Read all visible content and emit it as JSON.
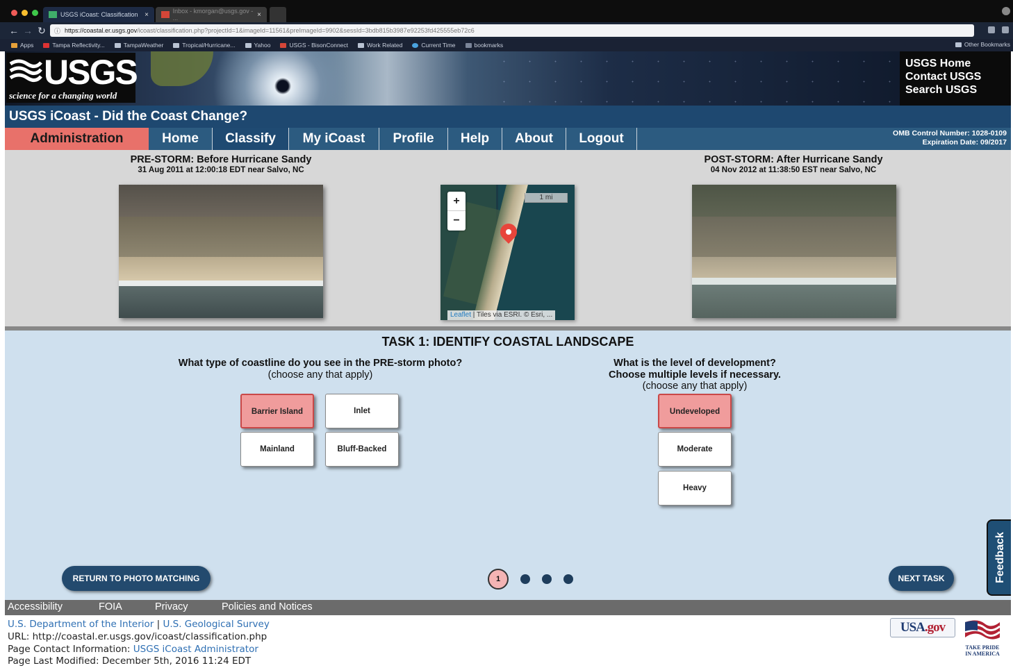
{
  "browser": {
    "tabs": [
      {
        "label": "USGS iCoast: Classification",
        "active": true
      },
      {
        "label": "Inbox - kmorgan@usgs.gov - ...",
        "active": false
      }
    ],
    "url_host": "https://coastal.er.usgs.gov",
    "url_path": "/icoast/classification.php?projectId=1&imageId=11561&preImageId=9902&sessId=3bdb815b3987e92253fd425555eb72c6",
    "bookmarks": [
      "Apps",
      "Tampa Reflectivity...",
      "TampaWeather",
      "Tropical/Hurricane...",
      "Yahoo",
      "USGS - BisonConnect",
      "Work Related",
      "Current Time",
      "bookmarks"
    ],
    "other_bookmarks": "Other Bookmarks"
  },
  "banner": {
    "logo_text": "USGS",
    "logo_tagline": "science for a changing world",
    "links": [
      "USGS Home",
      "Contact USGS",
      "Search USGS"
    ]
  },
  "title": "USGS iCoast - Did the Coast Change?",
  "nav": {
    "admin": "Administration",
    "items": [
      "Home",
      "Classify",
      "My iCoast",
      "Profile",
      "Help",
      "About",
      "Logout"
    ],
    "active": "Classify",
    "omb_line1": "OMB Control Number: 1028-0109",
    "omb_line2": "Expiration Date: 09/2017"
  },
  "photos": {
    "pre_title": "PRE-STORM: Before Hurricane Sandy",
    "pre_sub": "31 Aug 2011 at 12:00:18 EDT near Salvo, NC",
    "post_title": "POST-STORM: After Hurricane Sandy",
    "post_sub": "04 Nov 2012 at 11:38:50 EST near Salvo, NC",
    "map": {
      "zoom_in": "+",
      "zoom_out": "−",
      "scale": "1 mi",
      "attribution_link": "Leaflet",
      "attribution_text": " | Tiles via ESRI. © Esri, ..."
    }
  },
  "task": {
    "title": "TASK 1: IDENTIFY COASTAL LANDSCAPE",
    "q1_line1": "What type of coastline do you see in the PRE-storm photo?",
    "q1_line2": "(choose any that apply)",
    "q1_options": [
      {
        "label": "Barrier Island",
        "selected": true
      },
      {
        "label": "Inlet",
        "selected": false
      },
      {
        "label": "Mainland",
        "selected": false
      },
      {
        "label": "Bluff-Backed",
        "selected": false
      }
    ],
    "q2_line1": "What is the level of development?",
    "q2_line2": "Choose multiple levels if necessary.",
    "q2_line3": "(choose any that apply)",
    "q2_options": [
      {
        "label": "Undeveloped",
        "selected": true
      },
      {
        "label": "Moderate",
        "selected": false
      },
      {
        "label": "Heavy",
        "selected": false
      }
    ],
    "return_button": "RETURN TO PHOTO MATCHING",
    "next_button": "NEXT TASK",
    "current_page": "1",
    "feedback": "Feedback"
  },
  "footer": {
    "links": [
      "Accessibility",
      "FOIA",
      "Privacy",
      "Policies and Notices"
    ],
    "doi": "U.S. Department of the Interior",
    "sep": " | ",
    "usgs": "U.S. Geological Survey",
    "url_label": "URL: http://coastal.er.usgs.gov/icoast/classification.php",
    "contact_label": "Page Contact Information: ",
    "contact_link": "USGS iCoast Administrator",
    "modified": "Page Last Modified: December 5th, 2016 11:24 EDT",
    "usagov_a": "USA",
    "usagov_b": ".gov",
    "pride_1": "TAKE PRIDE",
    "pride_2": "IN AMERICA"
  },
  "colors": {
    "nav_blue": "#2c5b80",
    "title_blue": "#1e4870",
    "admin_red": "#e8716a",
    "selected_option": "#f09c9c",
    "task_bg": "#cfe0ee"
  }
}
